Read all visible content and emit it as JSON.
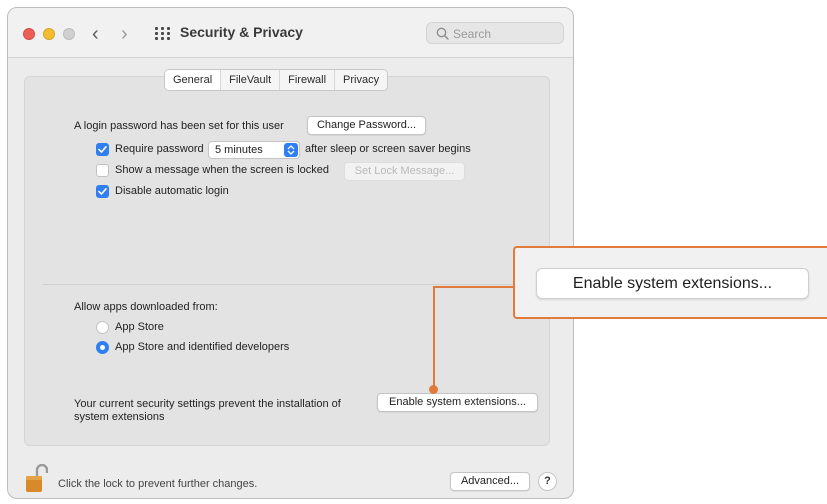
{
  "window": {
    "title": "Security & Privacy",
    "search_placeholder": "Search"
  },
  "tabs": [
    {
      "label": "General"
    },
    {
      "label": "FileVault"
    },
    {
      "label": "Firewall"
    },
    {
      "label": "Privacy"
    }
  ],
  "general": {
    "login_text": "A login password has been set for this user",
    "change_password_label": "Change Password...",
    "require_password": {
      "label": "Require password",
      "checked": true,
      "select_value": "5 minutes",
      "suffix": "after sleep or screen saver begins"
    },
    "show_message": {
      "label": "Show a message when the screen is locked",
      "checked": false,
      "button_label": "Set Lock Message..."
    },
    "disable_autologin": {
      "label": "Disable automatic login",
      "checked": true
    }
  },
  "allow_apps": {
    "heading": "Allow apps downloaded from:",
    "options": [
      {
        "label": "App Store",
        "selected": false
      },
      {
        "label": "App Store and identified developers",
        "selected": true
      }
    ]
  },
  "extensions": {
    "message_line1": "Your current security settings prevent the installation of",
    "message_line2": "system extensions",
    "button_label": "Enable system extensions..."
  },
  "footer": {
    "lock_text": "Click the lock to prevent further changes.",
    "advanced_label": "Advanced...",
    "help_label": "?"
  },
  "callout": {
    "label": "Enable system extensions...",
    "accent_color": "#e07b3c"
  },
  "accent_color": "#2f7ff2"
}
